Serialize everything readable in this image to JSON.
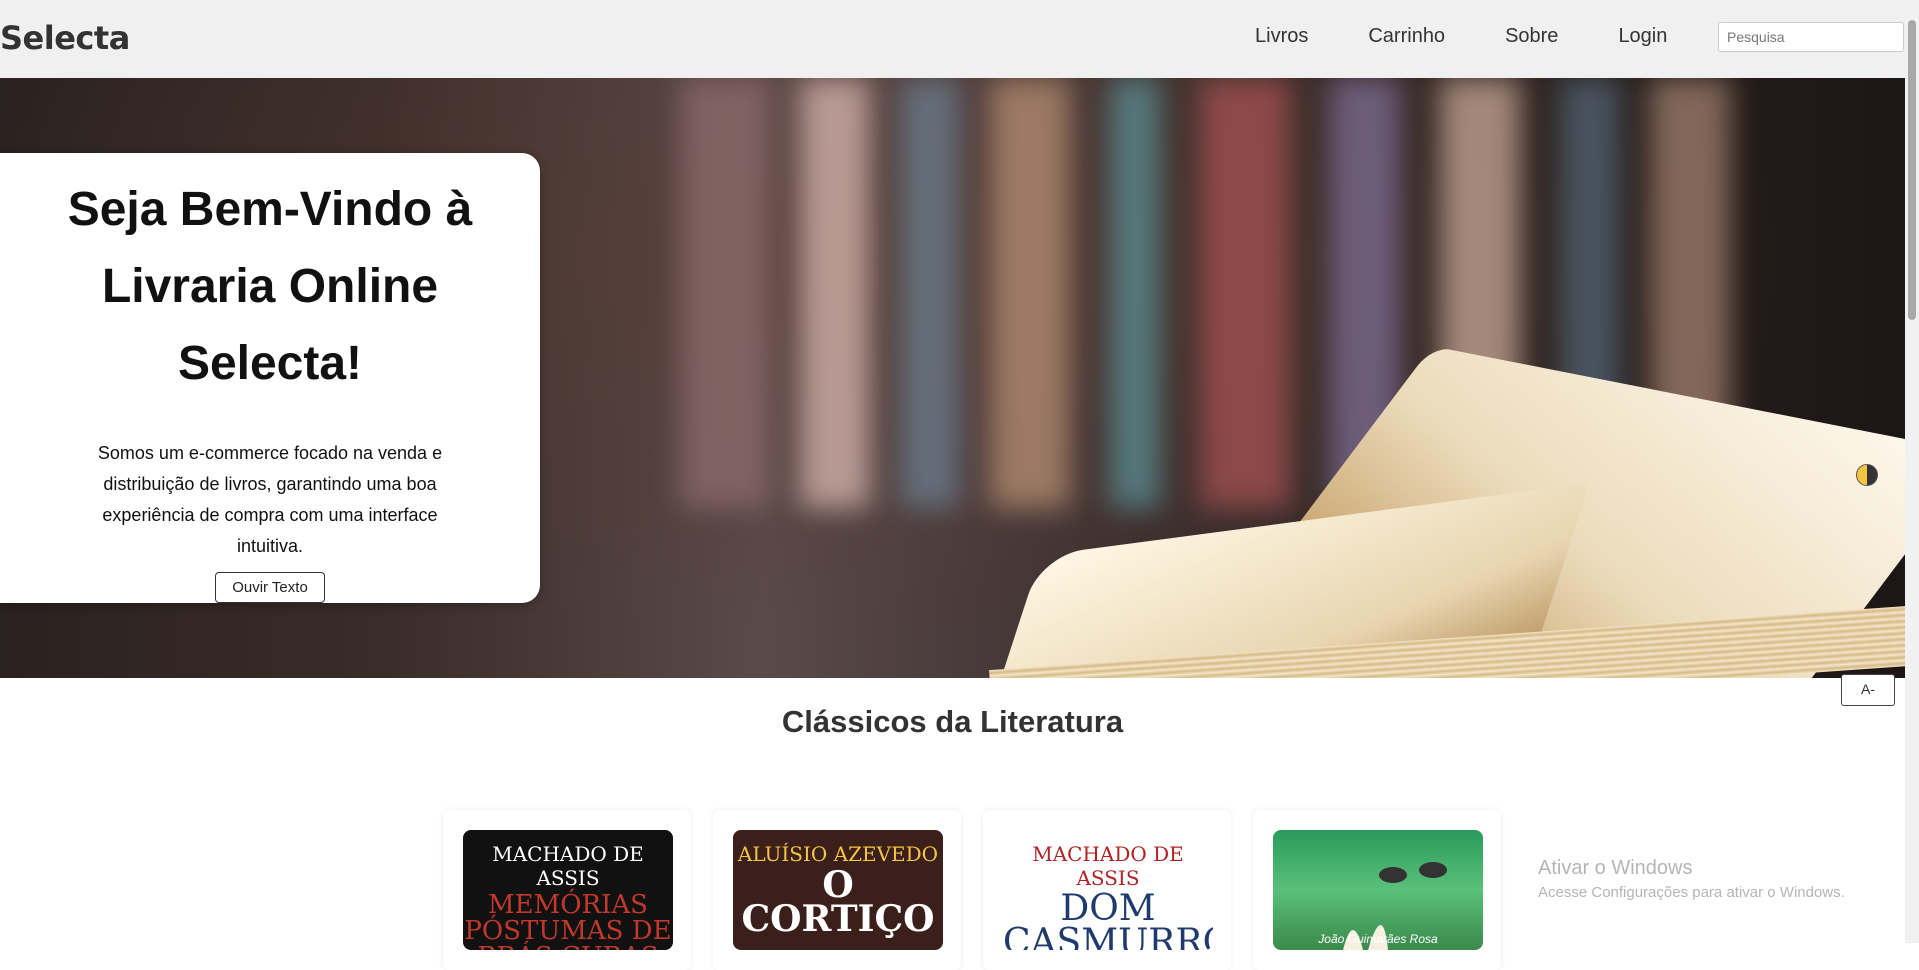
{
  "navbar": {
    "brand": "Selecta",
    "links": [
      "Livros",
      "Carrinho",
      "Sobre",
      "Login"
    ],
    "search_placeholder": "Pesquisa"
  },
  "hero": {
    "title": "Seja Bem-Vindo à Livraria Online Selecta!",
    "description": "Somos um e-commerce focado na venda e distribuição de livros, garantindo uma boa experiência de compra com uma interface intuitiva.",
    "listen_button": "Ouvir Texto"
  },
  "accessibility": {
    "font_decrease": "A-"
  },
  "section": {
    "title": "Clássicos da Literatura",
    "books": [
      {
        "author": "MACHADO DE ASSIS",
        "title": "MEMÓRIAS PÓSTUMAS DE BRÁS CUBAS"
      },
      {
        "author": "ALUÍSIO AZEVEDO",
        "title": "O CORTIÇO"
      },
      {
        "author": "MACHADO DE ASSIS",
        "title": "DOM CASMURRO"
      },
      {
        "author": "João Guimarães Rosa",
        "title": ""
      }
    ]
  },
  "watermark": {
    "title": "Ativar o Windows",
    "subtitle": "Acesse Configurações para ativar o Windows."
  },
  "colors": {
    "navbar_bg": "#f0f0f0",
    "memorias_title": "#c0392b",
    "cortico_author": "#f5c542",
    "dom_author": "#b22222",
    "dom_title": "#1f3b6e"
  }
}
